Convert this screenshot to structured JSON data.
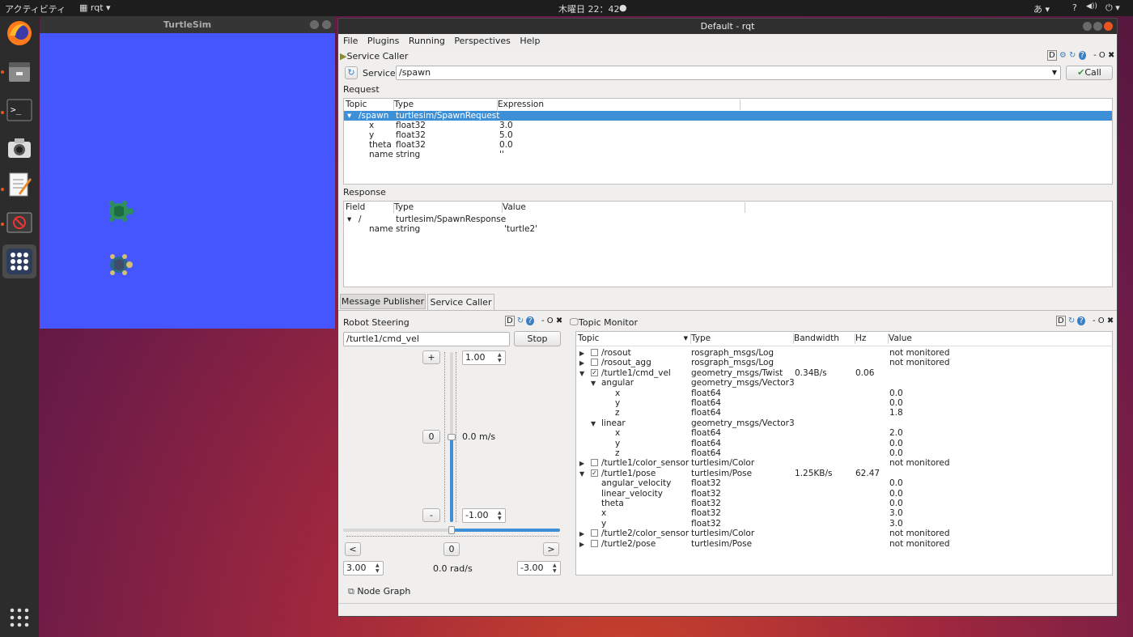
{
  "topbar": {
    "activities": "アクティビティ",
    "app": "rqt",
    "clock": "木曜日 22：42",
    "ime": "あ",
    "help": "?",
    "vol": "◀))",
    "power": "⏻"
  },
  "turtlesim": {
    "title": "TurtleSim",
    "bg": "#4556ff"
  },
  "rqt": {
    "title": "Default - rqt",
    "menu": [
      "File",
      "Plugins",
      "Running",
      "Perspectives",
      "Help"
    ],
    "service_caller": {
      "title": "Service Caller",
      "service_label": "Service",
      "service_value": "/spawn",
      "call_label": "Call",
      "request_label": "Request",
      "request_headers": [
        "Topic",
        "Type",
        "Expression"
      ],
      "request_rows": [
        [
          "/spawn",
          "turtlesim/SpawnRequest",
          ""
        ],
        [
          "x",
          "float32",
          "3.0"
        ],
        [
          "y",
          "float32",
          "5.0"
        ],
        [
          "theta",
          "float32",
          "0.0"
        ],
        [
          "name",
          "string",
          "''"
        ]
      ],
      "response_label": "Response",
      "response_headers": [
        "Field",
        "Type",
        "Value"
      ],
      "response_rows": [
        [
          "/",
          "turtlesim/SpawnResponse",
          ""
        ],
        [
          "name",
          "string",
          "'turtle2'"
        ]
      ]
    },
    "tabs": [
      "Message Publisher",
      "Service Caller"
    ],
    "robot_steering": {
      "title": "Robot Steering",
      "topic": "/turtle1/cmd_vel",
      "stop": "Stop",
      "plus": "+",
      "zero": "0",
      "minus": "-",
      "max_lin": "1.00",
      "min_lin": "-1.00",
      "lin_readout": "0.0 m/s",
      "left": "<",
      "right": ">",
      "max_ang": "3.00",
      "ang_readout": "0.0 rad/s",
      "min_ang": "-3.00",
      "linear_value": 0.0,
      "angular_value": 0.0
    },
    "topic_monitor": {
      "title": "Topic Monitor",
      "headers": [
        "Topic",
        "Type",
        "Bandwidth",
        "Hz",
        "Value"
      ],
      "rows": [
        {
          "d": 0,
          "exp": "right",
          "chk": "",
          "t": "/rosout",
          "ty": "rosgraph_msgs/Log",
          "bw": "",
          "hz": "",
          "v": "not monitored"
        },
        {
          "d": 0,
          "exp": "right",
          "chk": "",
          "t": "/rosout_agg",
          "ty": "rosgraph_msgs/Log",
          "bw": "",
          "hz": "",
          "v": "not monitored"
        },
        {
          "d": 0,
          "exp": "down",
          "chk": "✓",
          "t": "/turtle1/cmd_vel",
          "ty": "geometry_msgs/Twist",
          "bw": "0.34B/s",
          "hz": "0.06",
          "v": ""
        },
        {
          "d": 1,
          "exp": "down",
          "t": "angular",
          "ty": "geometry_msgs/Vector3",
          "bw": "",
          "hz": "",
          "v": ""
        },
        {
          "d": 2,
          "t": "x",
          "ty": "float64",
          "bw": "",
          "hz": "",
          "v": "0.0"
        },
        {
          "d": 2,
          "t": "y",
          "ty": "float64",
          "bw": "",
          "hz": "",
          "v": "0.0"
        },
        {
          "d": 2,
          "t": "z",
          "ty": "float64",
          "bw": "",
          "hz": "",
          "v": "1.8"
        },
        {
          "d": 1,
          "exp": "down",
          "t": "linear",
          "ty": "geometry_msgs/Vector3",
          "bw": "",
          "hz": "",
          "v": ""
        },
        {
          "d": 2,
          "t": "x",
          "ty": "float64",
          "bw": "",
          "hz": "",
          "v": "2.0"
        },
        {
          "d": 2,
          "t": "y",
          "ty": "float64",
          "bw": "",
          "hz": "",
          "v": "0.0"
        },
        {
          "d": 2,
          "t": "z",
          "ty": "float64",
          "bw": "",
          "hz": "",
          "v": "0.0"
        },
        {
          "d": 0,
          "exp": "right",
          "chk": "",
          "t": "/turtle1/color_sensor",
          "ty": "turtlesim/Color",
          "bw": "",
          "hz": "",
          "v": "not monitored"
        },
        {
          "d": 0,
          "exp": "down",
          "chk": "✓",
          "t": "/turtle1/pose",
          "ty": "turtlesim/Pose",
          "bw": "1.25KB/s",
          "hz": "62.47",
          "v": ""
        },
        {
          "d": 1,
          "t": "angular_velocity",
          "ty": "float32",
          "bw": "",
          "hz": "",
          "v": "0.0"
        },
        {
          "d": 1,
          "t": "linear_velocity",
          "ty": "float32",
          "bw": "",
          "hz": "",
          "v": "0.0"
        },
        {
          "d": 1,
          "t": "theta",
          "ty": "float32",
          "bw": "",
          "hz": "",
          "v": "0.0"
        },
        {
          "d": 1,
          "t": "x",
          "ty": "float32",
          "bw": "",
          "hz": "",
          "v": "3.0"
        },
        {
          "d": 1,
          "t": "y",
          "ty": "float32",
          "bw": "",
          "hz": "",
          "v": "3.0"
        },
        {
          "d": 0,
          "exp": "right",
          "chk": "",
          "t": "/turtle2/color_sensor",
          "ty": "turtlesim/Color",
          "bw": "",
          "hz": "",
          "v": "not monitored"
        },
        {
          "d": 0,
          "exp": "right",
          "chk": "",
          "t": "/turtle2/pose",
          "ty": "turtlesim/Pose",
          "bw": "",
          "hz": "",
          "v": "not monitored"
        }
      ]
    },
    "node_graph": "Node Graph",
    "plugin_ctrl": {
      "d": "D",
      "help": "?",
      "min": "- O",
      "close": "✖"
    }
  }
}
